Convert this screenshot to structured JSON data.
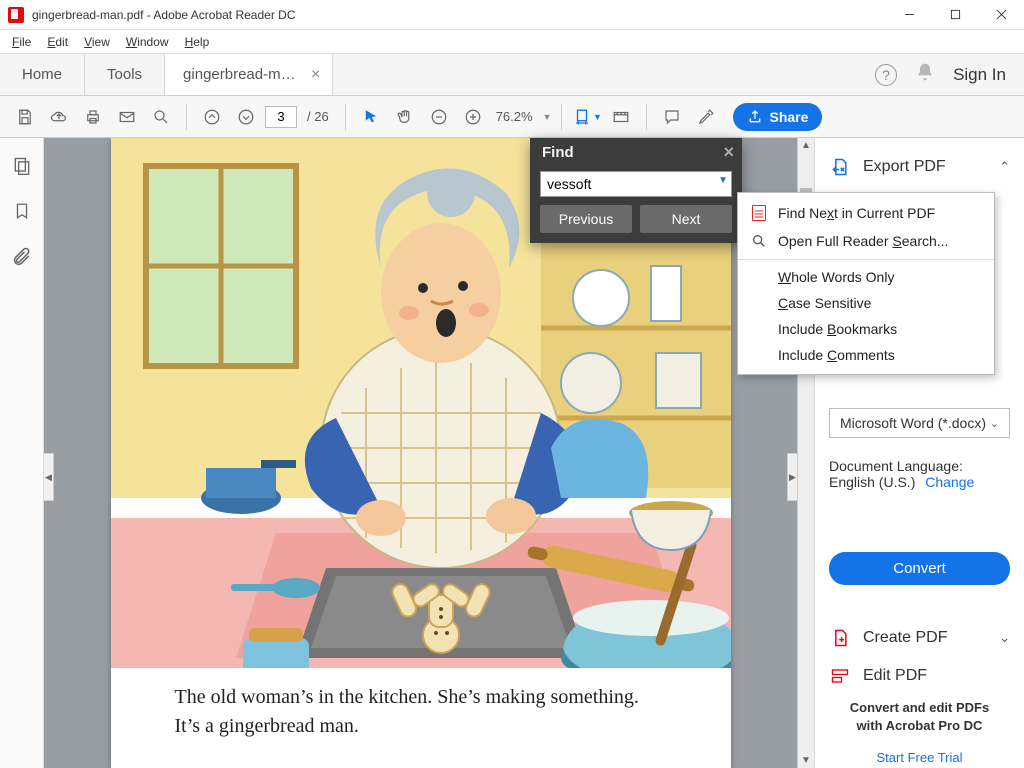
{
  "window": {
    "title": "gingerbread-man.pdf - Adobe Acrobat Reader DC"
  },
  "menu": [
    "File",
    "Edit",
    "View",
    "Window",
    "Help"
  ],
  "tabs": {
    "home": "Home",
    "tools": "Tools",
    "doc": "gingerbread-man.p..."
  },
  "signin": "Sign In",
  "toolbar": {
    "page_current": "3",
    "page_total": "/ 26",
    "zoom": "76.2%",
    "share": "Share"
  },
  "page_text": "The old woman’s in the kitchen. She’s making something. It’s a gingerbread man.",
  "find": {
    "title": "Find",
    "value": "vessoft",
    "prev": "Previous",
    "next": "Next"
  },
  "context_menu": {
    "find_next": "Find Next in Current PDF",
    "reader_search": "Open Full Reader Search...",
    "whole_words": "Whole Words Only",
    "case_sensitive": "Case Sensitive",
    "bookmarks": "Include Bookmarks",
    "comments": "Include Comments"
  },
  "right_panel": {
    "export": "Export PDF",
    "format": "Microsoft Word (*.docx)",
    "lang_label": "Document Language:",
    "lang_value": "English (U.S.)",
    "change": "Change",
    "convert": "Convert",
    "create": "Create PDF",
    "edit": "Edit PDF",
    "promo1": "Convert and edit PDFs",
    "promo2": "with Acrobat Pro DC",
    "trial": "Start Free Trial"
  }
}
